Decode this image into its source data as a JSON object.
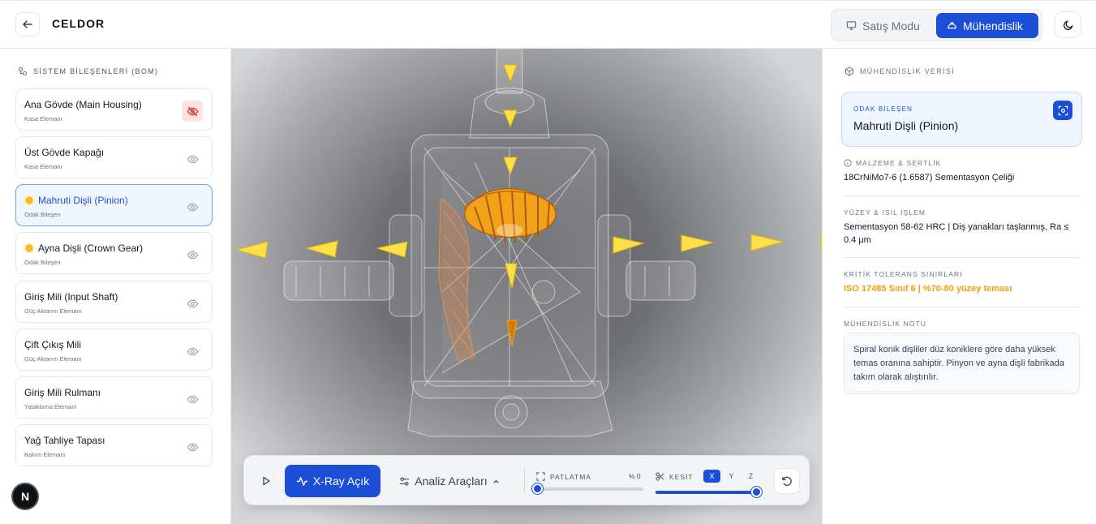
{
  "header": {
    "brand": "CELDOR",
    "modes": {
      "sales": "Satış Modu",
      "engineering": "Mühendislik"
    }
  },
  "sidebar": {
    "title": "SİSTEM BİLEŞENLERİ (BOM)",
    "items": [
      {
        "name": "Ana Gövde (Main Housing)",
        "sub": "Kasa Elemanı"
      },
      {
        "name": "Üst Gövde Kapağı",
        "sub": "Kasa Elemanı"
      },
      {
        "name": "Mahruti Dişli (Pinion)",
        "sub": "Odak Bileşen"
      },
      {
        "name": "Ayna Dişli (Crown Gear)",
        "sub": "Odak Bileşen"
      },
      {
        "name": "Giriş Mili (Input Shaft)",
        "sub": "Güç Aktarım Elemanı"
      },
      {
        "name": "Çift Çıkış Mili",
        "sub": "Güç Aktarım Elemanı"
      },
      {
        "name": "Giriş Mili Rulmanı",
        "sub": "Yataklama Elemanı"
      },
      {
        "name": "Yağ Tahliye Tapası",
        "sub": "Bakım Elemanı"
      }
    ],
    "badge": "N"
  },
  "toolbar": {
    "xray": "X-Ray Açık",
    "analysis": "Analiz Araçları",
    "explode_label": "PATLATMA",
    "explode_value": "% 0",
    "explode_fraction": 0,
    "cut_label": "KESİT",
    "cut_fraction": 1,
    "axes": [
      "X",
      "Y",
      "Z"
    ]
  },
  "panel": {
    "title": "MÜHENDİSLİK VERİSİ",
    "focus_label": "ODAK BİLEŞEN",
    "focus_name": "Mahruti Dişli (Pinion)",
    "material_label": "MALZEME & SERTLİK",
    "material_value": "18CrNiMo7-6 (1.6587) Sementasyon Çeliği",
    "surface_label": "YÜZEY & ISIL İŞLEM",
    "surface_value": "Sementasyon 58-62 HRC | Diş yanakları taşlanmış, Ra ≤ 0.4 μm",
    "tolerance_label": "KRİTİK TOLERANS SINIRLARI",
    "tolerance_value": "ISO 17485 Sınıf 6 | %70-80 yüzey teması",
    "note_label": "MÜHENDİSLİK NOTU",
    "note_value": "Spiral konik dişliler düz koniklere göre daha yüksek temas oranına sahiptir. Pinyon ve ayna dişli fabrikada takım olarak alıştırılır."
  },
  "colors": {
    "accent": "#1d4ed8",
    "warning": "#f59e0b",
    "gear": "#f59e0b",
    "arrows": "#fde047"
  }
}
